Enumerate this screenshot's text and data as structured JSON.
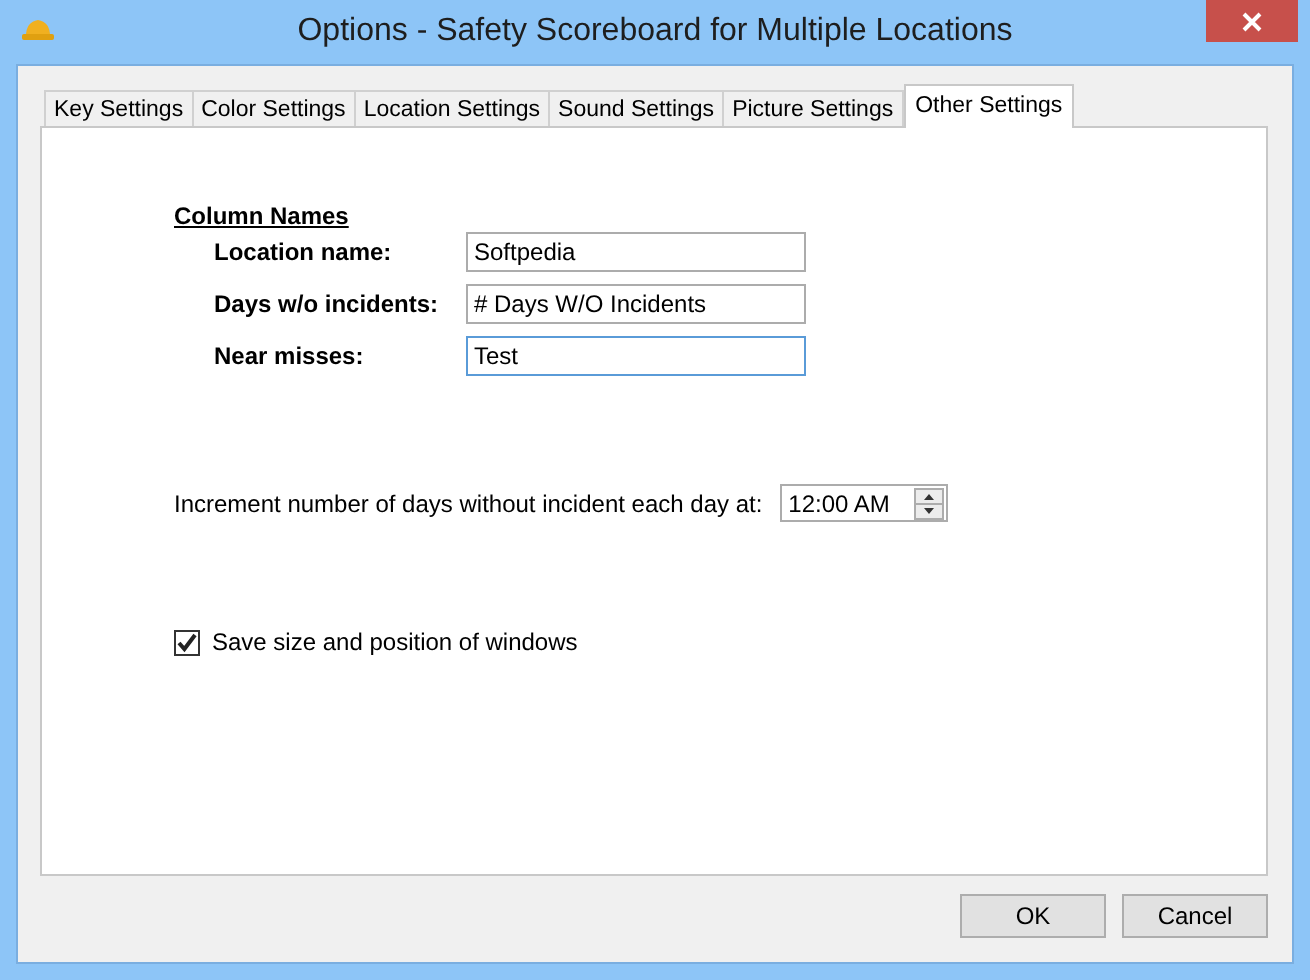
{
  "window": {
    "title": "Options - Safety Scoreboard for Multiple Locations"
  },
  "tabs": [
    {
      "label": "Key Settings",
      "selected": false
    },
    {
      "label": "Color Settings",
      "selected": false
    },
    {
      "label": "Location Settings",
      "selected": false
    },
    {
      "label": "Sound Settings",
      "selected": false
    },
    {
      "label": "Picture Settings",
      "selected": false
    },
    {
      "label": "Other Settings",
      "selected": true
    }
  ],
  "column_names": {
    "heading": "Column Names",
    "fields": [
      {
        "label": "Location name:",
        "value": "Softpedia",
        "focused": false
      },
      {
        "label": "Days w/o incidents:",
        "value": "# Days W/O Incidents",
        "focused": false
      },
      {
        "label": "Near misses:",
        "value": "Test",
        "focused": true
      }
    ]
  },
  "increment": {
    "label": "Increment number of days without incident each day at:",
    "value": "12:00 AM"
  },
  "save_size": {
    "label": "Save size and position of windows",
    "checked": true
  },
  "buttons": [
    "OK",
    "Cancel"
  ]
}
